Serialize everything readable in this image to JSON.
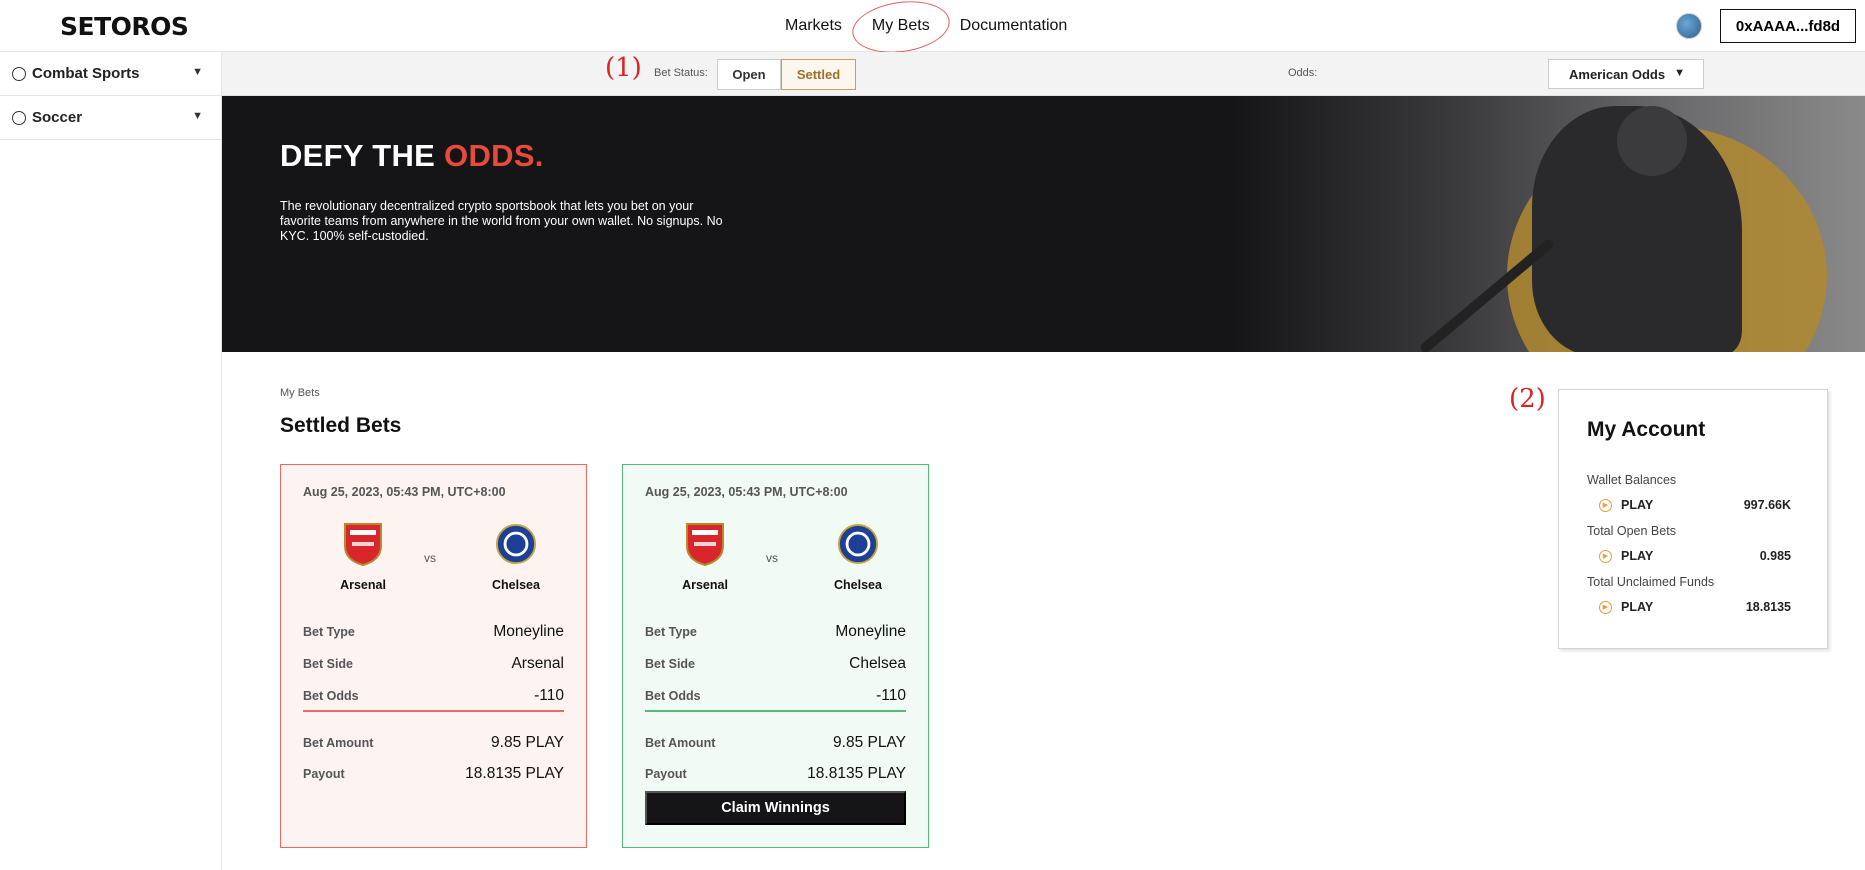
{
  "brand": {
    "logo_text": "SETOROS"
  },
  "nav": {
    "links": [
      "Markets",
      "My Bets",
      "Documentation"
    ],
    "wallet_address": "0xAAAA...fd8d"
  },
  "sidebar": {
    "items": [
      {
        "label": "Combat Sports",
        "icon": "combat-icon"
      },
      {
        "label": "Soccer",
        "icon": "soccer-ball-icon"
      }
    ]
  },
  "annotations": {
    "one": "(1)",
    "two": "(2)"
  },
  "filters": {
    "bet_status_label": "Bet Status:",
    "open_label": "Open",
    "settled_label": "Settled",
    "selected_status": "Settled",
    "odds_label": "Odds:",
    "odds_value": "American Odds"
  },
  "hero": {
    "title_main": "DEFY THE ",
    "title_accent": "ODDS.",
    "description": "The revolutionary decentralized crypto sportsbook that lets you bet on your favorite teams from anywhere in the world from your own wallet. No signups. No KYC. 100% self-custodied."
  },
  "page": {
    "breadcrumb": "My Bets",
    "title": "Settled Bets"
  },
  "bets": [
    {
      "result": "lost",
      "date": "Aug 25, 2023, 05:43 PM, UTC+8:00",
      "home_team": "Arsenal",
      "away_team": "Chelsea",
      "vs": "vs",
      "bet_type_label": "Bet Type",
      "bet_type": "Moneyline",
      "bet_side_label": "Bet Side",
      "bet_side": "Arsenal",
      "bet_odds_label": "Bet Odds",
      "bet_odds": "-110",
      "bet_amount_label": "Bet Amount",
      "bet_amount": "9.85 PLAY",
      "payout_label": "Payout",
      "payout": "18.8135 PLAY"
    },
    {
      "result": "won",
      "date": "Aug 25, 2023, 05:43 PM, UTC+8:00",
      "home_team": "Arsenal",
      "away_team": "Chelsea",
      "vs": "vs",
      "bet_type_label": "Bet Type",
      "bet_type": "Moneyline",
      "bet_side_label": "Bet Side",
      "bet_side": "Chelsea",
      "bet_odds_label": "Bet Odds",
      "bet_odds": "-110",
      "bet_amount_label": "Bet Amount",
      "bet_amount": "9.85 PLAY",
      "payout_label": "Payout",
      "payout": "18.8135 PLAY",
      "claim_label": "Claim Winnings"
    }
  ],
  "account": {
    "title": "My Account",
    "wallet_balances_label": "Wallet Balances",
    "wallet_token": "PLAY",
    "wallet_amount": "997.66K",
    "open_bets_label": "Total Open Bets",
    "open_token": "PLAY",
    "open_amount": "0.985",
    "unclaimed_label": "Total Unclaimed Funds",
    "unclaimed_token": "PLAY",
    "unclaimed_amount": "18.8135"
  },
  "colors": {
    "accent_red": "#e84a3b",
    "lost_border": "#ea6b63",
    "won_border": "#55bb7c",
    "settled_gold": "#c9a15c",
    "coin_orange": "#e6a03a"
  }
}
